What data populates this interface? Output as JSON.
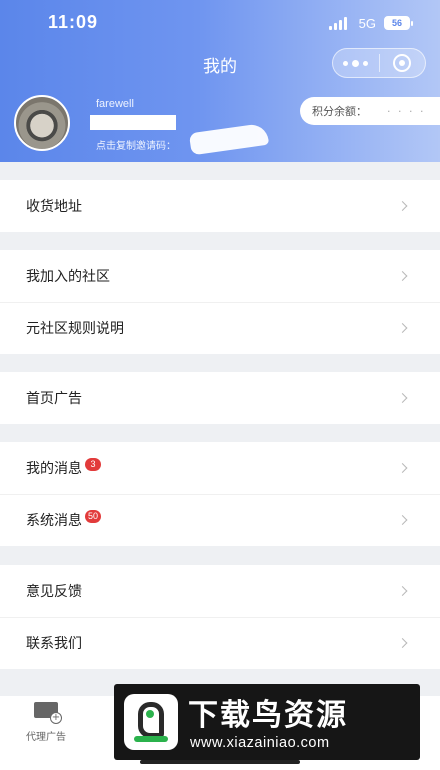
{
  "status_bar": {
    "time": "11:09",
    "network": "5G",
    "battery": "56"
  },
  "header": {
    "title": "我的"
  },
  "profile": {
    "username": "farewell",
    "invite_label": "点击复制邀请码：",
    "points_label": "积分余额：",
    "points_value": "· · · ·"
  },
  "menu_groups": [
    {
      "items": [
        {
          "label": "收货地址"
        }
      ]
    },
    {
      "items": [
        {
          "label": "我加入的社区"
        },
        {
          "label": "元社区规则说明"
        }
      ]
    },
    {
      "items": [
        {
          "label": "首页广告"
        }
      ]
    },
    {
      "items": [
        {
          "label": "我的消息",
          "badge": "3"
        },
        {
          "label": "系统消息",
          "badge": "50"
        }
      ]
    },
    {
      "items": [
        {
          "label": "意见反馈"
        },
        {
          "label": "联系我们"
        }
      ]
    }
  ],
  "tabbar": {
    "agent_label": "代理广告"
  },
  "watermark": {
    "title": "下载鸟资源",
    "url": "www.xiazainiao.com"
  },
  "colors": {
    "header_start": "#5b86ea",
    "header_end": "#b2c7f6",
    "badge": "#e23b3b"
  }
}
